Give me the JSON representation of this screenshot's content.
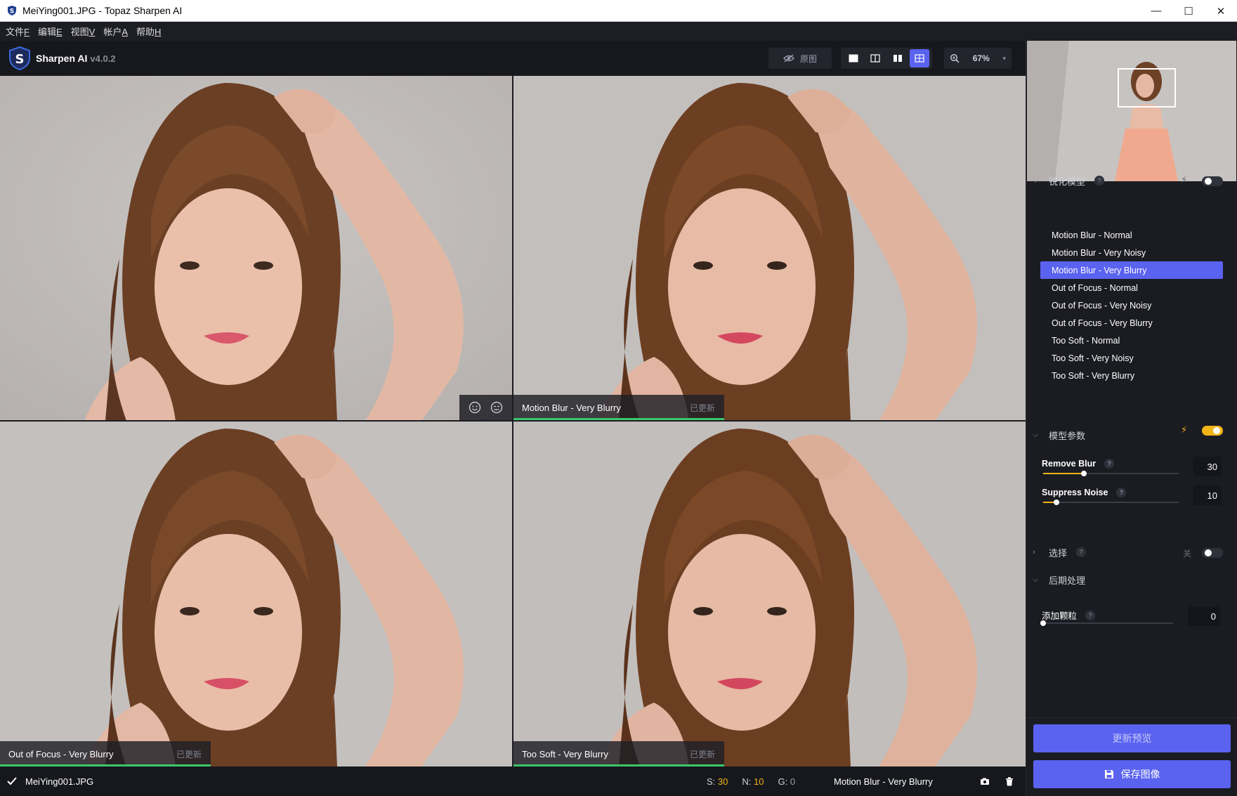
{
  "window": {
    "title": "MeiYing001.JPG - Topaz Sharpen AI",
    "minimize": "—",
    "maximize": "☐",
    "close": "✕"
  },
  "menu": [
    {
      "label": "文件",
      "accel": "F"
    },
    {
      "label": "编辑",
      "accel": "E"
    },
    {
      "label": "视图",
      "accel": "V"
    },
    {
      "label": "帐户",
      "accel": "A"
    },
    {
      "label": "帮助",
      "accel": "H"
    }
  ],
  "header": {
    "app_name": "Sharpen AI",
    "version": "v4.0.2",
    "original_label": "原图",
    "zoom": "67%"
  },
  "panes": [
    {
      "model": "Motion Blur - Very Blurry",
      "status": "已更新"
    },
    {
      "model": "Out of Focus - Very Blurry",
      "status": "已更新"
    },
    {
      "model": "Too Soft - Very Blurry",
      "status": "已更新"
    }
  ],
  "status_bar": {
    "filename": "MeiYing001.JPG",
    "s_label": "S:",
    "s_value": "30",
    "n_label": "N:",
    "n_value": "10",
    "g_label": "G:",
    "g_value": "0",
    "current_model": "Motion Blur - Very Blurry"
  },
  "panel": {
    "sharpen_model": {
      "title": "锐化模型",
      "help": "?",
      "models": [
        "Motion Blur - Normal",
        "Motion Blur - Very Noisy",
        "Motion Blur - Very Blurry",
        "Out of Focus - Normal",
        "Out of Focus - Very Noisy",
        "Out of Focus - Very Blurry",
        "Too Soft - Normal",
        "Too Soft - Very Noisy",
        "Too Soft - Very Blurry"
      ],
      "selected_index": 2
    },
    "model_params": {
      "title": "模型参数",
      "help": "?",
      "remove_blur": {
        "label": "Remove Blur",
        "value": "30",
        "level": 0.3
      },
      "suppress_noise": {
        "label": "Suppress Noise",
        "value": "10",
        "level": 0.1
      }
    },
    "selection": {
      "title": "选择",
      "help": "?",
      "state": "关"
    },
    "post": {
      "title": "后期处理",
      "grain": {
        "label": "添加颗粒",
        "help": "?",
        "value": "0",
        "level": 0
      }
    },
    "update_preview": "更新预览",
    "save_image": "保存图像"
  },
  "colors": {
    "accent": "#5a62f0",
    "slider": "#f2b418",
    "updated_bar": "#3cc66b"
  }
}
